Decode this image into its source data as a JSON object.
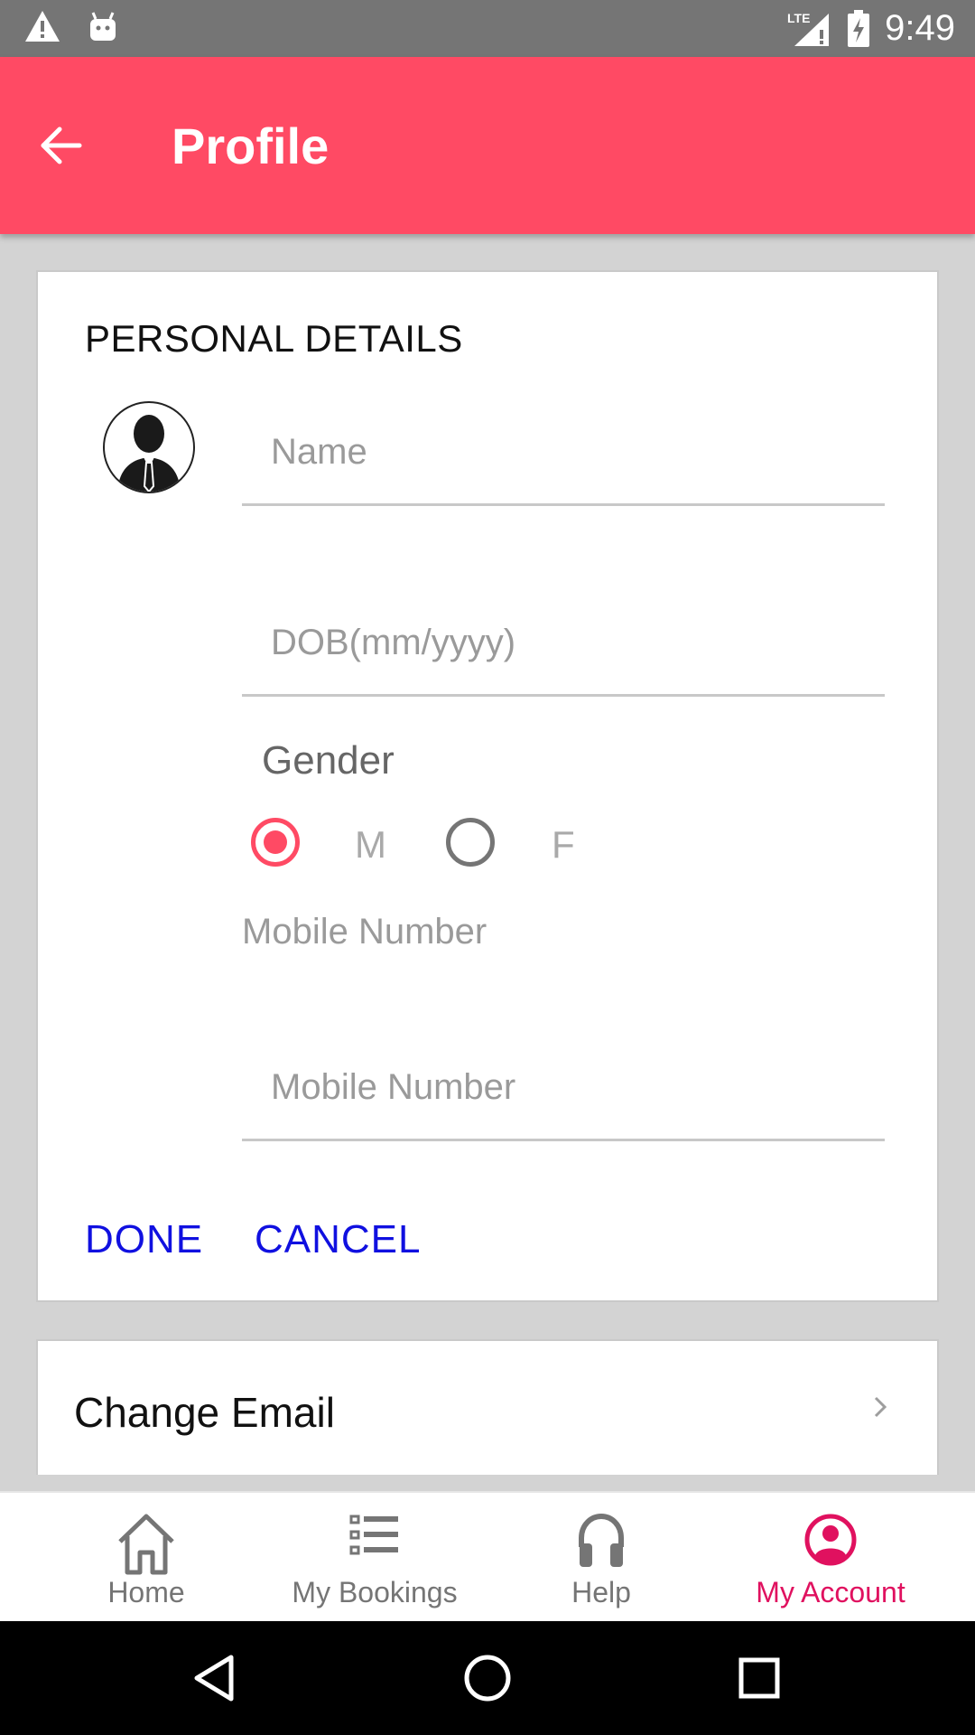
{
  "status_bar": {
    "time": "9:49",
    "network": "LTE",
    "icons": [
      "warning-icon",
      "android-icon",
      "lte-signal-icon",
      "battery-charging-icon"
    ]
  },
  "app_bar": {
    "title": "Profile",
    "back_icon": "arrow-left-icon",
    "background": "#ff4a64"
  },
  "personal_details": {
    "title": "PERSONAL DETAILS",
    "avatar_icon": "person-silhouette-icon",
    "name_placeholder": "Name",
    "dob_placeholder": "DOB(mm/yyyy)",
    "gender_label": "Gender",
    "gender_options": [
      {
        "label": "M",
        "selected": true
      },
      {
        "label": "F",
        "selected": false
      }
    ],
    "mobile_label": "Mobile Number",
    "mobile_placeholder": "Mobile Number",
    "done_label": "DONE",
    "cancel_label": "CANCEL"
  },
  "change_email": {
    "label": "Change Email"
  },
  "bottom_nav": {
    "items": [
      {
        "label": "Home",
        "icon": "home-icon",
        "active": false
      },
      {
        "label": "My Bookings",
        "icon": "list-icon",
        "active": false
      },
      {
        "label": "Help",
        "icon": "headset-icon",
        "active": false
      },
      {
        "label": "My Account",
        "icon": "account-circle-icon",
        "active": true
      }
    ],
    "active_color": "#e0115f"
  },
  "system_nav": {
    "icons": [
      "back-triangle-icon",
      "home-circle-icon",
      "recents-square-icon"
    ]
  }
}
